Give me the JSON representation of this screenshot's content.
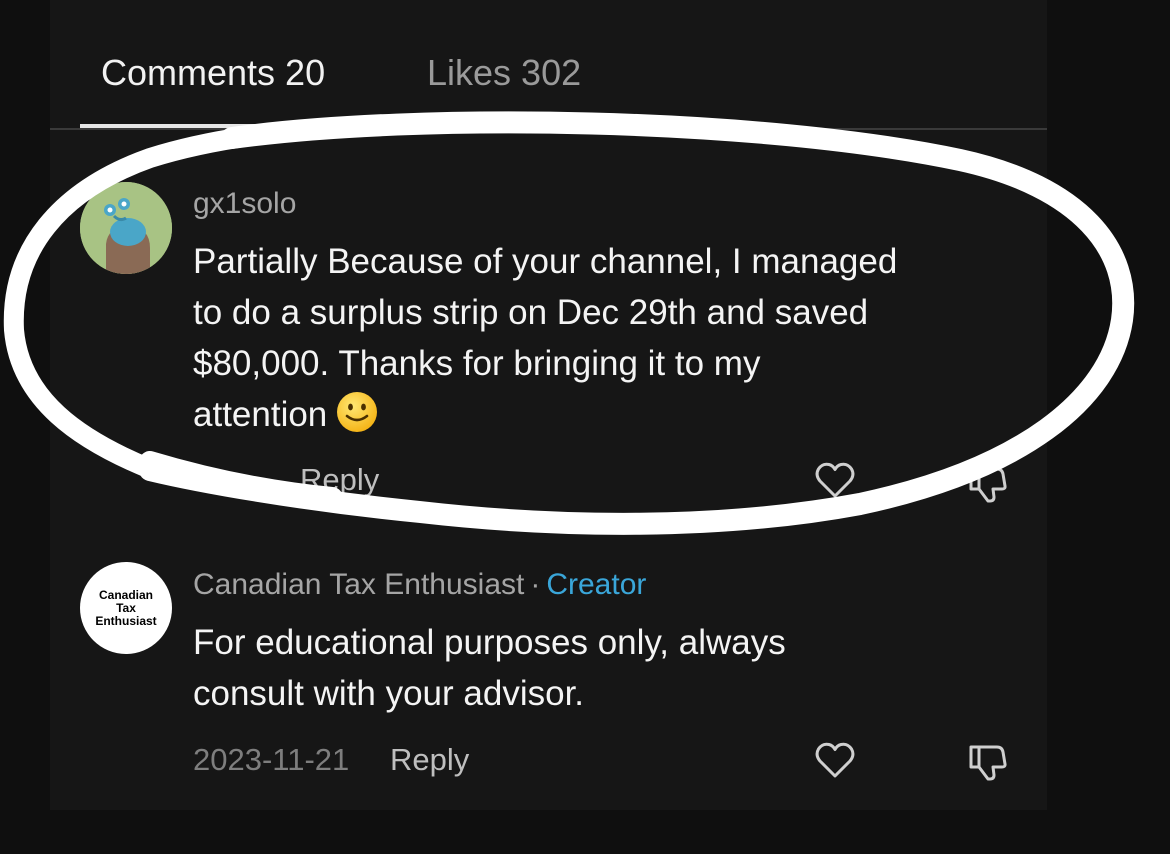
{
  "tabs": {
    "comments_label": "Comments 20",
    "likes_label": "Likes 302"
  },
  "comments": [
    {
      "username": "gx1solo",
      "text_lines": [
        "Partially Because of your channel, I managed",
        "to do a surplus strip on Dec 29th and saved",
        "$80,000. Thanks for bringing it to my",
        "attention"
      ],
      "reply_label": "Reply"
    },
    {
      "username": "Canadian Tax Enthusiast",
      "separator": "·",
      "badge": "Creator",
      "avatar_text": [
        "Canadian",
        "Tax",
        "Enthusiast"
      ],
      "text_lines": [
        "For educational purposes only, always",
        "consult with your advisor."
      ],
      "date": "2023-11-21",
      "reply_label": "Reply"
    }
  ],
  "icons": {
    "like": "heart-outline-icon",
    "dislike": "thumbs-down-icon",
    "emoji": "slightly-smiling-face-icon"
  },
  "colors": {
    "background": "#0f0f0f",
    "panel": "#161616",
    "creator_badge": "#3aa6d9",
    "highlight_marker": "#ffffff"
  }
}
